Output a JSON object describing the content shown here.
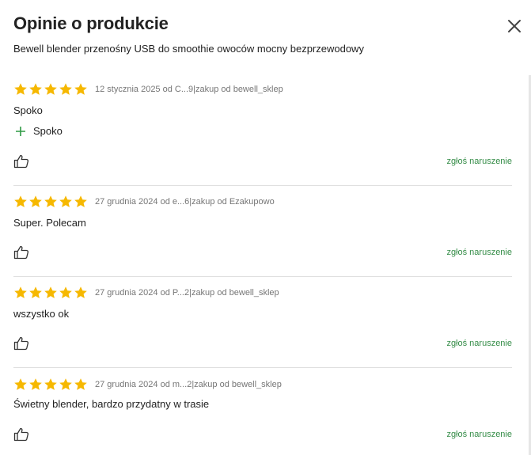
{
  "modal": {
    "title": "Opinie o produkcie",
    "product_name": "Bewell blender przenośny USB do smoothie owoców mocny bezprzewodowy"
  },
  "colors": {
    "star": "#f6b800",
    "report_link": "#348c47",
    "pro_icon": "#2f9a44"
  },
  "icons": {
    "close": "close-icon",
    "star": "star-icon",
    "plus": "plus-icon",
    "like": "thumbs-up-icon"
  },
  "reviews": [
    {
      "rating": 5,
      "date_author": "12 stycznia 2025 od C...9",
      "separator": "|",
      "source": "zakup od bewell_sklep",
      "text": "Spoko",
      "pros": [
        "Spoko"
      ],
      "report_label": "zgłoś naruszenie"
    },
    {
      "rating": 5,
      "date_author": "27 grudnia 2024 od e...6",
      "separator": "|",
      "source": "zakup od Ezakupowo",
      "text": "Super. Polecam",
      "pros": [],
      "report_label": "zgłoś naruszenie"
    },
    {
      "rating": 5,
      "date_author": "27 grudnia 2024 od P...2",
      "separator": "|",
      "source": "zakup od bewell_sklep",
      "text": "wszystko ok",
      "pros": [],
      "report_label": "zgłoś naruszenie"
    },
    {
      "rating": 5,
      "date_author": "27 grudnia 2024 od m...2",
      "separator": "|",
      "source": "zakup od bewell_sklep",
      "text": "Świetny blender, bardzo przydatny w trasie",
      "pros": [],
      "report_label": "zgłoś naruszenie"
    }
  ]
}
